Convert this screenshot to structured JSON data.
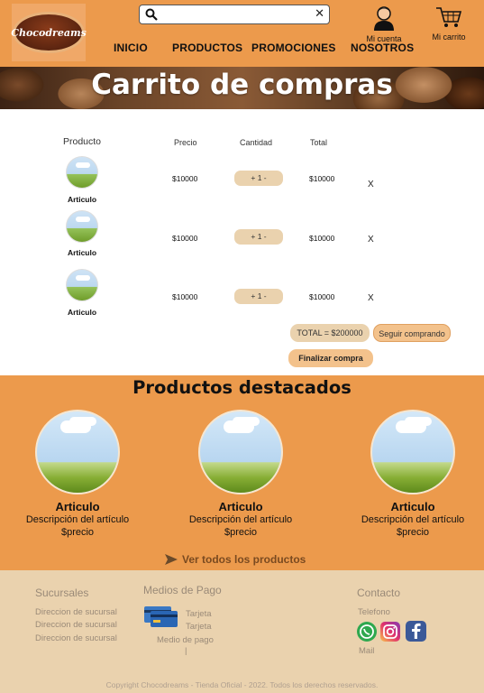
{
  "header": {
    "logo_text": "Chocodreams",
    "search": {
      "value": "",
      "placeholder": ""
    },
    "nav": [
      "INICIO",
      "PRODUCTOS",
      "PROMOCIONES",
      "NOSOTROS"
    ],
    "account_label": "Mi cuenta",
    "cart_label": "Mi carrito"
  },
  "banner": {
    "title": "Carrito de compras"
  },
  "cart": {
    "headers": {
      "product": "Producto",
      "price": "Precio",
      "quantity": "Cantidad",
      "total": "Total"
    },
    "rows": [
      {
        "name": "Articulo",
        "price": "$10000",
        "quantity": "+ 1 -",
        "total": "$10000",
        "remove": "X"
      },
      {
        "name": "Articulo",
        "price": "$10000",
        "quantity": "+ 1 -",
        "total": "$10000",
        "remove": "X"
      },
      {
        "name": "Articulo",
        "price": "$10000",
        "quantity": "+ 1 -",
        "total": "$10000",
        "remove": "X"
      }
    ],
    "total": "TOTAL = $200000",
    "continue_label": "Seguir comprando",
    "checkout_label": "Finalizar compra"
  },
  "featured": {
    "title": "Productos destacados",
    "products": [
      {
        "name": "Articulo",
        "description": "Descripción del artículo",
        "price": "$precio"
      },
      {
        "name": "Articulo",
        "description": "Descripción del artículo",
        "price": "$precio"
      },
      {
        "name": "Articulo",
        "description": "Descripción del artículo",
        "price": "$precio"
      }
    ],
    "see_all_label": "Ver todos los productos"
  },
  "footer": {
    "branches": {
      "title": "Sucursales",
      "items": [
        "Direccion de sucursal",
        "Direccion de sucursal",
        "Direccion de sucursal"
      ]
    },
    "payment": {
      "title": "Medios de Pago",
      "items": [
        "Tarjeta",
        "Tarjeta",
        "Medio de pago",
        "|"
      ]
    },
    "contact": {
      "title": "Contacto",
      "phone": "Telefono",
      "mail": "Mail"
    },
    "copyright": "Copyright Chocodreams - Tienda Oficial - 2022. Todos los derechos reservados."
  },
  "colors": {
    "primary": "#ec9a4c",
    "footer_bg": "#ead2ae",
    "pill": "#ead2ae",
    "button": "#f3c28c"
  }
}
